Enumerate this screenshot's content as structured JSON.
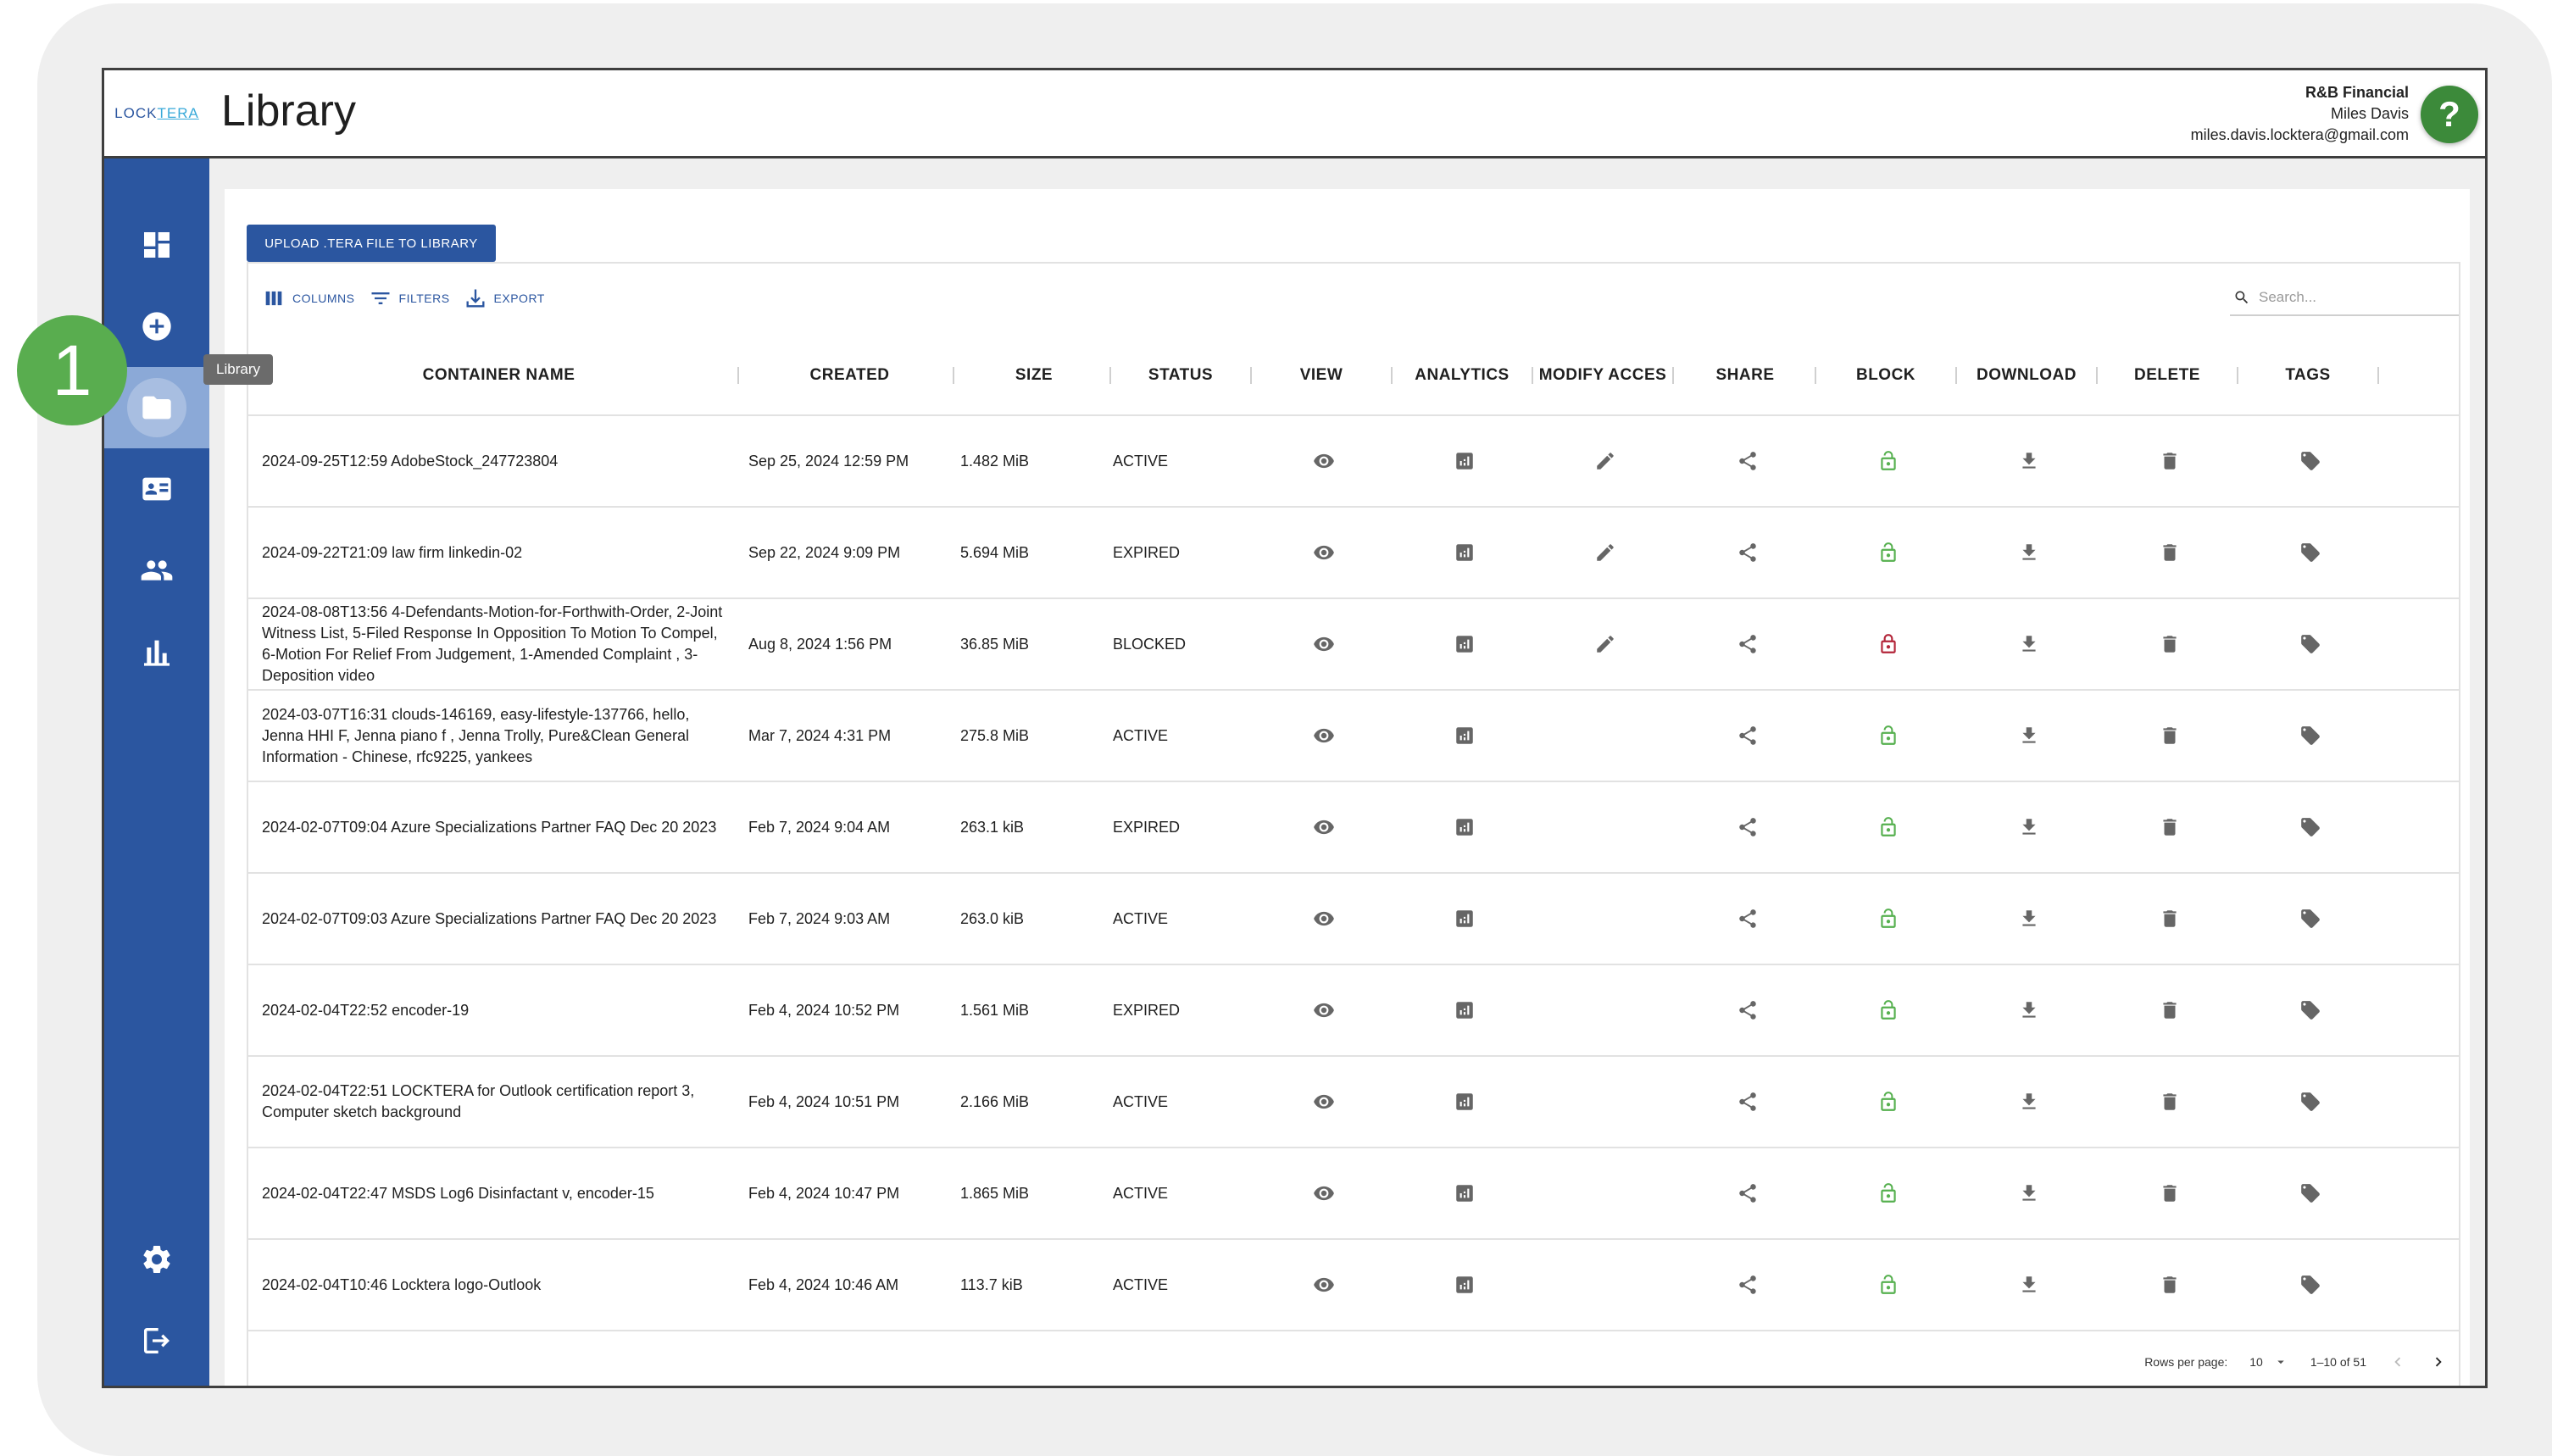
{
  "app": {
    "logo_part1": "LOCK",
    "logo_part2": "TERA",
    "page_title": "Library"
  },
  "account": {
    "org": "R&B Financial",
    "user": "Miles Davis",
    "email": "miles.davis.locktera@gmail.com",
    "help_label": "?"
  },
  "sidebar": {
    "items": [
      {
        "name": "dashboard",
        "icon": "dashboard-icon"
      },
      {
        "name": "create",
        "icon": "add-circle-icon"
      },
      {
        "name": "library",
        "icon": "folder-icon",
        "active": true
      },
      {
        "name": "contacts",
        "icon": "contact-card-icon"
      },
      {
        "name": "users",
        "icon": "people-icon"
      },
      {
        "name": "reports",
        "icon": "bar-chart-icon"
      },
      {
        "name": "settings",
        "icon": "gear-icon"
      },
      {
        "name": "logout",
        "icon": "logout-icon"
      }
    ],
    "tooltip": "Library"
  },
  "callout": {
    "number": "1"
  },
  "toolbar": {
    "upload_label": "UPLOAD .TERA FILE TO LIBRARY",
    "columns_label": "COLUMNS",
    "filters_label": "FILTERS",
    "export_label": "EXPORT",
    "search_placeholder": "Search..."
  },
  "table": {
    "columns": [
      "CONTAINER NAME",
      "CREATED",
      "SIZE",
      "STATUS",
      "VIEW",
      "ANALYTICS",
      "MODIFY ACCES",
      "SHARE",
      "BLOCK",
      "DOWNLOAD",
      "DELETE",
      "TAGS"
    ],
    "rows": [
      {
        "name": "2024-09-25T12:59 AdobeStock_247723804",
        "created": "Sep 25, 2024 12:59 PM",
        "size": "1.482 MiB",
        "status": "ACTIVE",
        "modify": true,
        "blocked": false
      },
      {
        "name": "2024-09-22T21:09 law firm linkedin-02",
        "created": "Sep 22, 2024 9:09 PM",
        "size": "5.694 MiB",
        "status": "EXPIRED",
        "modify": true,
        "blocked": false
      },
      {
        "name": "2024-08-08T13:56 4-Defendants-Motion-for-Forthwith-Order, 2-Joint Witness List, 5-Filed Response In Opposition To Motion To Compel, 6-Motion For Relief From Judgement, 1-Amended Complaint , 3-Deposition video",
        "created": "Aug 8, 2024 1:56 PM",
        "size": "36.85 MiB",
        "status": "BLOCKED",
        "modify": true,
        "blocked": true
      },
      {
        "name": "2024-03-07T16:31 clouds-146169, easy-lifestyle-137766, hello, Jenna HHI F, Jenna piano f , Jenna Trolly, Pure&Clean General Information - Chinese, rfc9225, yankees",
        "created": "Mar 7, 2024 4:31 PM",
        "size": "275.8 MiB",
        "status": "ACTIVE",
        "modify": false,
        "blocked": false
      },
      {
        "name": "2024-02-07T09:04 Azure Specializations Partner FAQ Dec 20 2023",
        "created": "Feb 7, 2024 9:04 AM",
        "size": "263.1 kiB",
        "status": "EXPIRED",
        "modify": false,
        "blocked": false
      },
      {
        "name": "2024-02-07T09:03 Azure Specializations Partner FAQ Dec 20 2023",
        "created": "Feb 7, 2024 9:03 AM",
        "size": "263.0 kiB",
        "status": "ACTIVE",
        "modify": false,
        "blocked": false
      },
      {
        "name": "2024-02-04T22:52 encoder-19",
        "created": "Feb 4, 2024 10:52 PM",
        "size": "1.561 MiB",
        "status": "EXPIRED",
        "modify": false,
        "blocked": false
      },
      {
        "name": "2024-02-04T22:51 LOCKTERA for Outlook certification report 3, Computer sketch background",
        "created": "Feb 4, 2024 10:51 PM",
        "size": "2.166 MiB",
        "status": "ACTIVE",
        "modify": false,
        "blocked": false
      },
      {
        "name": "2024-02-04T22:47 MSDS Log6 Disinfactant v, encoder-15",
        "created": "Feb 4, 2024 10:47 PM",
        "size": "1.865 MiB",
        "status": "ACTIVE",
        "modify": false,
        "blocked": false
      },
      {
        "name": "2024-02-04T10:46 Locktera logo-Outlook",
        "created": "Feb 4, 2024 10:46 AM",
        "size": "113.7 kiB",
        "status": "ACTIVE",
        "modify": false,
        "blocked": false
      }
    ]
  },
  "pagination": {
    "rows_per_page_label": "Rows per page:",
    "rows_per_page": "10",
    "range": "1–10 of 51"
  },
  "colors": {
    "sidebar": "#2b56a0",
    "accent": "#2b56a0",
    "help": "#3c8a3a",
    "lock_open": "#56b04f",
    "lock_closed": "#b3263a",
    "callout": "#59ad4f"
  }
}
